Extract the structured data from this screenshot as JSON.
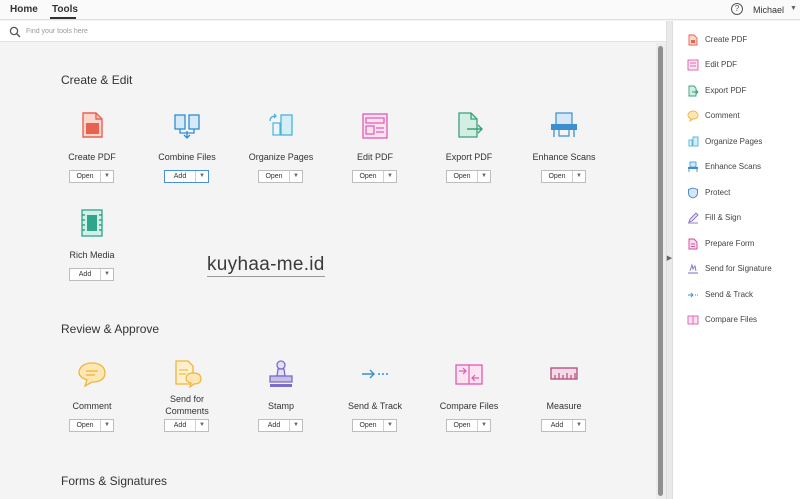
{
  "nav": {
    "home": "Home",
    "tools": "Tools",
    "help_glyph": "?",
    "user": "Michael"
  },
  "search": {
    "placeholder": "Find your tools here"
  },
  "sections": [
    {
      "title": "Create & Edit",
      "tools": [
        {
          "label": "Create PDF",
          "action": "Open",
          "icon": "create-pdf-icon",
          "color": "#e8634f"
        },
        {
          "label": "Combine Files",
          "action": "Add",
          "icon": "combine-files-icon",
          "color": "#2c8fd4"
        },
        {
          "label": "Organize Pages",
          "action": "Open",
          "icon": "organize-pages-icon",
          "color": "#4ab3d8"
        },
        {
          "label": "Edit PDF",
          "action": "Open",
          "icon": "edit-pdf-icon",
          "color": "#e05bb2"
        },
        {
          "label": "Export PDF",
          "action": "Open",
          "icon": "export-pdf-icon",
          "color": "#3aa07a"
        },
        {
          "label": "Enhance Scans",
          "action": "Open",
          "icon": "enhance-scans-icon",
          "color": "#3b8fd0"
        },
        {
          "label": "Rich Media",
          "action": "Add",
          "icon": "rich-media-icon",
          "color": "#2fa58c"
        }
      ]
    },
    {
      "title": "Review & Approve",
      "tools": [
        {
          "label": "Comment",
          "action": "Open",
          "icon": "comment-icon",
          "color": "#f2b43a"
        },
        {
          "label": "Send for",
          "label2": "Comments",
          "action": "Add",
          "icon": "send-for-comments-icon",
          "color": "#f2b43a"
        },
        {
          "label": "Stamp",
          "action": "Add",
          "icon": "stamp-icon",
          "color": "#7a6ec9"
        },
        {
          "label": "Send & Track",
          "action": "Open",
          "icon": "send-track-icon",
          "color": "#3a8fd0"
        },
        {
          "label": "Compare Files",
          "action": "Open",
          "icon": "compare-files-icon",
          "color": "#e05bb2"
        },
        {
          "label": "Measure",
          "action": "Add",
          "icon": "measure-icon",
          "color": "#b34a7a"
        }
      ]
    },
    {
      "title": "Forms & Signatures",
      "tools": []
    }
  ],
  "right_panel": [
    {
      "label": "Create PDF",
      "icon": "create-pdf-icon",
      "color": "#e8634f"
    },
    {
      "label": "Edit PDF",
      "icon": "edit-pdf-icon",
      "color": "#e05bb2"
    },
    {
      "label": "Export PDF",
      "icon": "export-pdf-icon",
      "color": "#3aa07a"
    },
    {
      "label": "Comment",
      "icon": "comment-icon",
      "color": "#f2b43a"
    },
    {
      "label": "Organize Pages",
      "icon": "organize-pages-icon",
      "color": "#4ab3d8"
    },
    {
      "label": "Enhance Scans",
      "icon": "enhance-scans-icon",
      "color": "#3b8fd0"
    },
    {
      "label": "Protect",
      "icon": "protect-icon",
      "color": "#3b7fd0"
    },
    {
      "label": "Fill & Sign",
      "icon": "fill-sign-icon",
      "color": "#8a6ec9"
    },
    {
      "label": "Prepare Form",
      "icon": "prepare-form-icon",
      "color": "#d0489a"
    },
    {
      "label": "Send for Signature",
      "icon": "send-for-signature-icon",
      "color": "#7a6ec9"
    },
    {
      "label": "Send & Track",
      "icon": "send-track-icon",
      "color": "#3a8fd0"
    },
    {
      "label": "Compare Files",
      "icon": "compare-files-icon",
      "color": "#e05bb2"
    }
  ],
  "watermark": "kuyhaa-me.id"
}
